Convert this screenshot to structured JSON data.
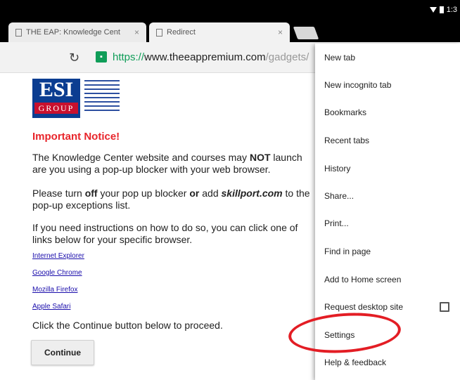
{
  "status_bar": {
    "time": "1:3"
  },
  "tabs": [
    {
      "title": "THE EAP: Knowledge Cent",
      "close": "×"
    },
    {
      "title": "Redirect",
      "close": "×"
    }
  ],
  "toolbar": {
    "reload_icon": "reload-icon",
    "url_scheme": "https://",
    "url_host": "www.theeappremium.com",
    "url_path": "/gadgets/"
  },
  "page": {
    "logo": {
      "top": "ESI",
      "bottom": "GROUP"
    },
    "notice_title": "Important Notice!",
    "para1_line1_a": "The Knowledge Center website and courses may ",
    "para1_line1_bold": "NOT",
    "para1_line1_b": " launch",
    "para1_line2": "are you using a pop-up blocker with your web browser.",
    "para2_line1_a": "Please turn ",
    "para2_line1_bold1": "off",
    "para2_line1_b": " your pop up blocker ",
    "para2_line1_bold2": "or",
    "para2_line1_c": " add ",
    "para2_line1_italic": "skillport.com",
    "para2_line1_d": " to the",
    "para2_line2": "pop-up exceptions list.",
    "para3_line1": "If you need instructions on how to do so, you can click one of",
    "para3_line2": "links below for your specific browser.",
    "browser_links": [
      "Internet Explorer",
      "Google Chrome",
      "Mozilla Firefox",
      "Apple Safari"
    ],
    "proceed_text": "Click the Continue button below to proceed.",
    "continue_label": "Continue"
  },
  "menu": {
    "items": [
      "New tab",
      "New incognito tab",
      "Bookmarks",
      "Recent tabs",
      "History",
      "Share...",
      "Print...",
      "Find in page",
      "Add to Home screen",
      "Request desktop site",
      "Settings",
      "Help & feedback"
    ]
  },
  "accent_colors": {
    "notice": "#e8252b",
    "secure": "#0f9d58",
    "annotation": "#e31d24"
  }
}
